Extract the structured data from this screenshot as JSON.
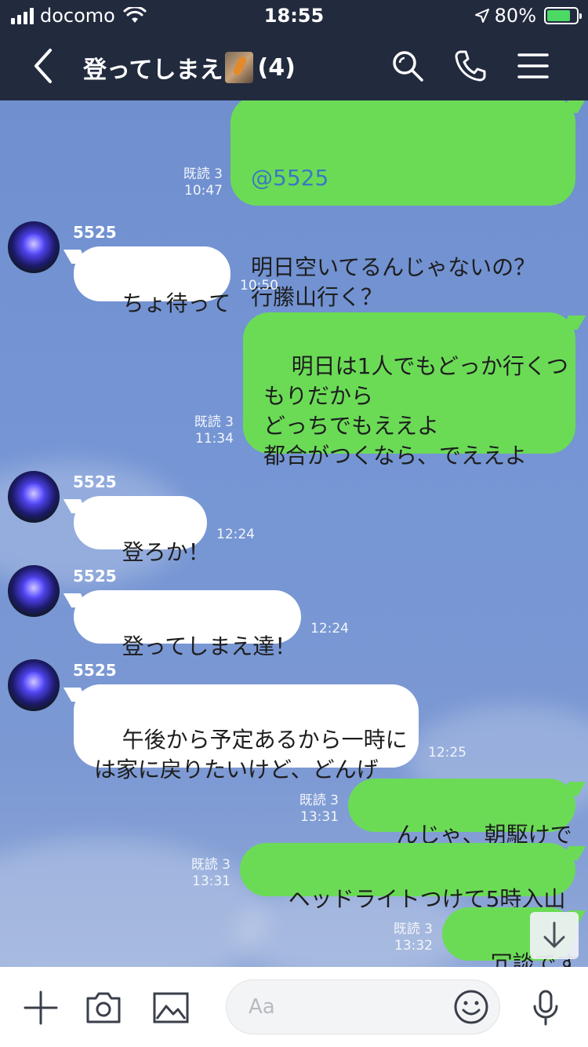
{
  "status_bar": {
    "carrier": "docomo",
    "time": "18:55",
    "battery": "80%"
  },
  "header": {
    "title": "登ってしまえ",
    "member_count": "(4)",
    "icons": [
      "back-icon",
      "search-icon",
      "phone-icon",
      "menu-icon"
    ]
  },
  "messages": [
    {
      "side": "me",
      "mention": "@5525",
      "text": "明日空いてるんじゃないの？\n行縢山行く？",
      "read": "既読 3",
      "time": "10:47"
    },
    {
      "side": "them",
      "sender": "5525",
      "text": "ちょ待って",
      "time": "10:50"
    },
    {
      "side": "me",
      "text": "明日は1人でもどっか行くつ\nもりだから\nどっちでもええよ\n都合がつくなら、でええよ",
      "read": "既読 3",
      "time": "11:34"
    },
    {
      "side": "them",
      "sender": "5525",
      "text": "登ろか！",
      "time": "12:24"
    },
    {
      "side": "them",
      "sender": "5525",
      "text": "登ってしまえ達！",
      "time": "12:24"
    },
    {
      "side": "them",
      "sender": "5525",
      "text": "午後から予定あるから一時に\nは家に戻りたいけど、どんげ",
      "time": "12:25"
    },
    {
      "side": "me",
      "text": "んじゃ、朝駆けで",
      "read": "既読 3",
      "time": "13:31"
    },
    {
      "side": "me",
      "text": "ヘッドライトつけて5時入山",
      "read": "既読 3",
      "time": "13:31"
    },
    {
      "side": "me",
      "text": "冗談です",
      "read": "既読 3",
      "time": "13:32"
    }
  ],
  "input_bar": {
    "placeholder": "Aa",
    "icons": [
      "plus-icon",
      "camera-icon",
      "image-icon",
      "emoji-icon",
      "mic-icon"
    ]
  },
  "colors": {
    "header_bg": "#222a3e",
    "my_bubble": "#6bdb56",
    "their_bubble": "#ffffff",
    "mention": "#3b78c2"
  }
}
